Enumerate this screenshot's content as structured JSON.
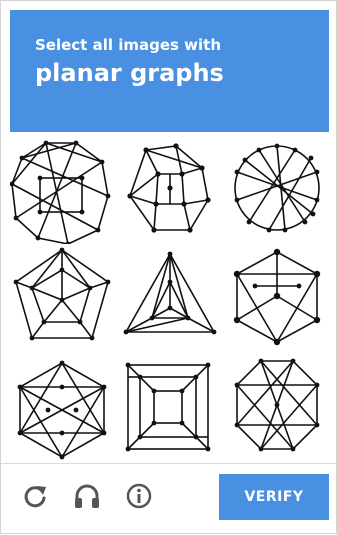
{
  "header": {
    "instruction": "Select all images with",
    "target": "planar graphs"
  },
  "tiles": [
    {
      "graph": "complex-polygon-graph"
    },
    {
      "graph": "heptagon-graph"
    },
    {
      "graph": "circle-star-graph"
    },
    {
      "graph": "pentagon-graph"
    },
    {
      "graph": "triangle-graph"
    },
    {
      "graph": "hexagon-cube-graph"
    },
    {
      "graph": "hexagon-star-graph"
    },
    {
      "graph": "nested-squares-graph"
    },
    {
      "graph": "octagon-graph"
    }
  ],
  "footer": {
    "reload_icon": "reload-icon",
    "audio_icon": "headphones-icon",
    "info_icon": "info-icon",
    "verify_label": "VERIFY"
  },
  "colors": {
    "accent": "#4a90e2",
    "icon": "#555555"
  }
}
